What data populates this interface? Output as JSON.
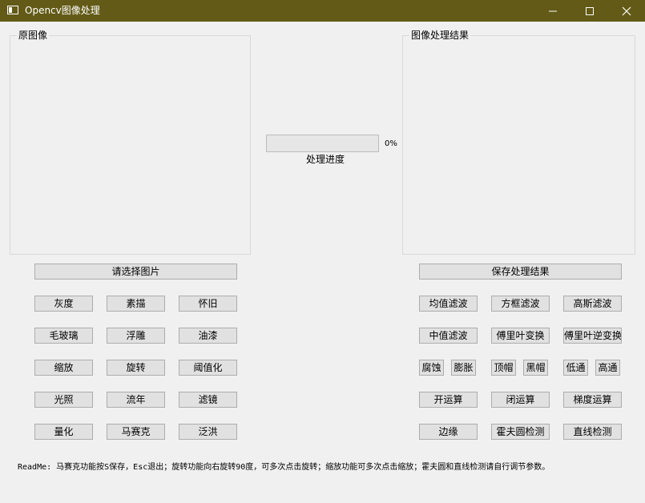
{
  "window": {
    "title": "Opencv图像处理"
  },
  "groups": {
    "original": "原图像",
    "result": "图像处理结果"
  },
  "progress": {
    "value": 0,
    "percent_text": "0%",
    "label": "处理进度"
  },
  "buttons": {
    "select_image": "请选择图片",
    "save_result": "保存处理结果",
    "left": [
      "灰度",
      "素描",
      "怀旧",
      "毛玻璃",
      "浮雕",
      "油漆",
      "缩放",
      "旋转",
      "阈值化",
      "光照",
      "流年",
      "滤镜",
      "量化",
      "马赛克",
      "泛洪"
    ],
    "right": {
      "row1": [
        "均值滤波",
        "方框滤波",
        "高斯滤波"
      ],
      "row2": [
        "中值滤波",
        "傅里叶变换",
        "傅里叶逆变换"
      ],
      "row3": [
        "腐蚀",
        "膨胀",
        "顶帽",
        "黑帽",
        "低通",
        "高通"
      ],
      "row4": [
        "开运算",
        "闭运算",
        "梯度运算"
      ],
      "row5": [
        "边缘",
        "霍夫圆检测",
        "直线检测"
      ]
    }
  },
  "readme": "ReadMe: 马赛克功能按S保存，Esc退出；旋转功能向右旋转90度，可多次点击旋转；缩放功能可多次点击缩放；霍夫圆和直线检测请自行调节参数。"
}
